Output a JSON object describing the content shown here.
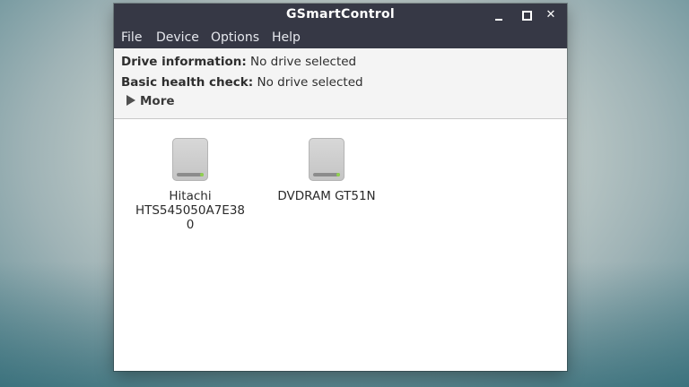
{
  "window": {
    "title": "GSmartControl",
    "controls": {
      "minimize_icon": "minimize-icon",
      "maximize_icon": "maximize-icon",
      "close_glyph": "✕"
    }
  },
  "menubar": {
    "items": [
      {
        "label": "File"
      },
      {
        "label": "Device"
      },
      {
        "label": "Options"
      },
      {
        "label": "Help"
      }
    ]
  },
  "info": {
    "drive_information_label": "Drive information:",
    "drive_information_value": "No drive selected",
    "health_check_label": "Basic health check:",
    "health_check_value": "No drive selected",
    "more_label": "More",
    "more_icon": "expander-triangle-right-icon"
  },
  "drives": [
    {
      "label_line1": "Hitachi",
      "label_line2": "HTS545050A7E38",
      "label_line3": "0",
      "icon": "hard-disk-icon"
    },
    {
      "label_line1": "DVDRAM GT51N",
      "icon": "hard-disk-icon"
    }
  ],
  "colors": {
    "titlebar": "#363845",
    "menubar": "#363845",
    "panel": "#f4f4f4",
    "drive_led": "#8fd14f"
  }
}
